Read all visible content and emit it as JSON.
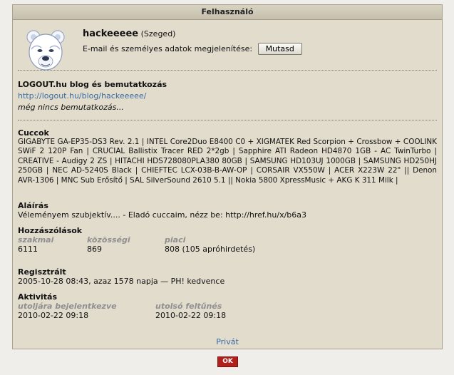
{
  "dialog": {
    "title": "Felhasználó"
  },
  "user": {
    "username": "hackeeeee",
    "location": "(Szeged)",
    "email_prompt": "E-mail és személyes adatok megjelenítése:",
    "show_button": "Mutasd",
    "avatar_icon": "polar-bear-avatar-icon"
  },
  "blog": {
    "heading": "LOGOUT.hu blog és bemutatkozás",
    "url": "http://logout.hu/blog/hackeeeee/",
    "intro": "még nincs bemutatkozás..."
  },
  "hardware": {
    "heading": "Cuccok",
    "text": "GIGABYTE GA-EP35-DS3 Rev. 2.1 | INTEL Core2Duo E8400 C0 + XIGMATEK Red Scorpion + Crossbow + COOLINK SWiF 2 120P Fan | CRUCIAL Ballistix Tracer RED 2*2gb | Sapphire ATI Radeon HD4870 1GB - AC TwinTurbo | CREATIVE - Audigy 2 ZS | HITACHI HDS728080PLA380 80GB | SAMSUNG HD103UJ 1000GB | SAMSUNG HD250HJ 250GB | NEC AD-5240S Black | CHIEFTEC LCX-03B-B-AW-OP | CORSAIR VX550W | ACER X223W 22\" || Denon AVR-1306 | MNC Sub Erősítő | SAL SilverSound 2610 5.1 || Nokia 5800 XpressMusic + AKG K 311 Milk |"
  },
  "signature": {
    "heading": "Aláírás",
    "text": "Véleményem szubjektív.... - Eladó cuccaim, nézz be: http://href.hu/x/b6a3"
  },
  "posts": {
    "heading": "Hozzászólások",
    "cols": [
      {
        "label": "szakmai",
        "value": "6111"
      },
      {
        "label": "közösségi",
        "value": "869"
      },
      {
        "label": "piaci",
        "value": "808 (105 apróhirdetés)"
      }
    ]
  },
  "registered": {
    "heading": "Regisztrált",
    "text": "2005-10-28 08:43, azaz 1578 napja — PH! kedvence"
  },
  "activity": {
    "heading": "Aktivitás",
    "cols": [
      {
        "label": "utoljára bejelentkezve",
        "value": "2010-02-22 09:18"
      },
      {
        "label": "utolsó feltűnés",
        "value": "2010-02-22 09:18"
      }
    ]
  },
  "footer": {
    "private_link": "Privát",
    "ok_button": "OK"
  },
  "colors": {
    "panel_bg": "#e2dccd",
    "link": "#3b6aa0",
    "ok_red": "#b1201a",
    "col_label": "#8f8f8f"
  }
}
